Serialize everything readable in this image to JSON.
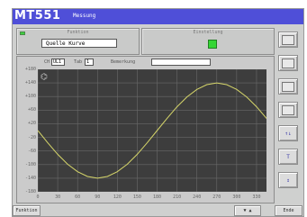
{
  "window": {
    "app_title": "MT551",
    "subtitle": "Messung"
  },
  "panel_function": {
    "title": "Funktion",
    "value": "Quelle Kurve"
  },
  "panel_settings": {
    "title": "Einstellung"
  },
  "graph": {
    "channel_label": "CH",
    "channel_value": "UL1",
    "tab_label": "Tab",
    "tab_value": "1",
    "comment_label": "Bemerkung",
    "comment_value": "",
    "y_ticks": [
      "+180",
      "+140",
      "+100",
      "+60",
      "+20",
      "-20",
      "-60",
      "-100",
      "-140",
      "-180"
    ],
    "x_ticks": [
      "0",
      "30",
      "60",
      "90",
      "120",
      "150",
      "180",
      "210",
      "240",
      "270",
      "300",
      "330"
    ],
    "line_color": "#d6d66a",
    "grid_color": "#6a6a6a"
  },
  "chart_data": {
    "type": "line",
    "x": [
      0,
      15,
      30,
      45,
      60,
      75,
      90,
      105,
      120,
      135,
      150,
      165,
      180,
      195,
      210,
      225,
      240,
      255,
      270,
      285,
      300,
      315,
      330,
      345,
      360
    ],
    "values": [
      0,
      -36,
      -70,
      -99,
      -121,
      -135,
      -140,
      -135,
      -121,
      -99,
      -70,
      -36,
      0,
      36,
      70,
      99,
      121,
      135,
      140,
      135,
      121,
      99,
      70,
      36,
      0
    ],
    "xlim": [
      0,
      345
    ],
    "ylim": [
      -180,
      180
    ],
    "grid": true
  },
  "bottom": {
    "left_button": "Funktion",
    "updown_button": "▼ ▲",
    "right_button": "Ende"
  },
  "sidebar": {
    "btn5": "↑↓",
    "btn6": "T",
    "btn7": "↕"
  }
}
